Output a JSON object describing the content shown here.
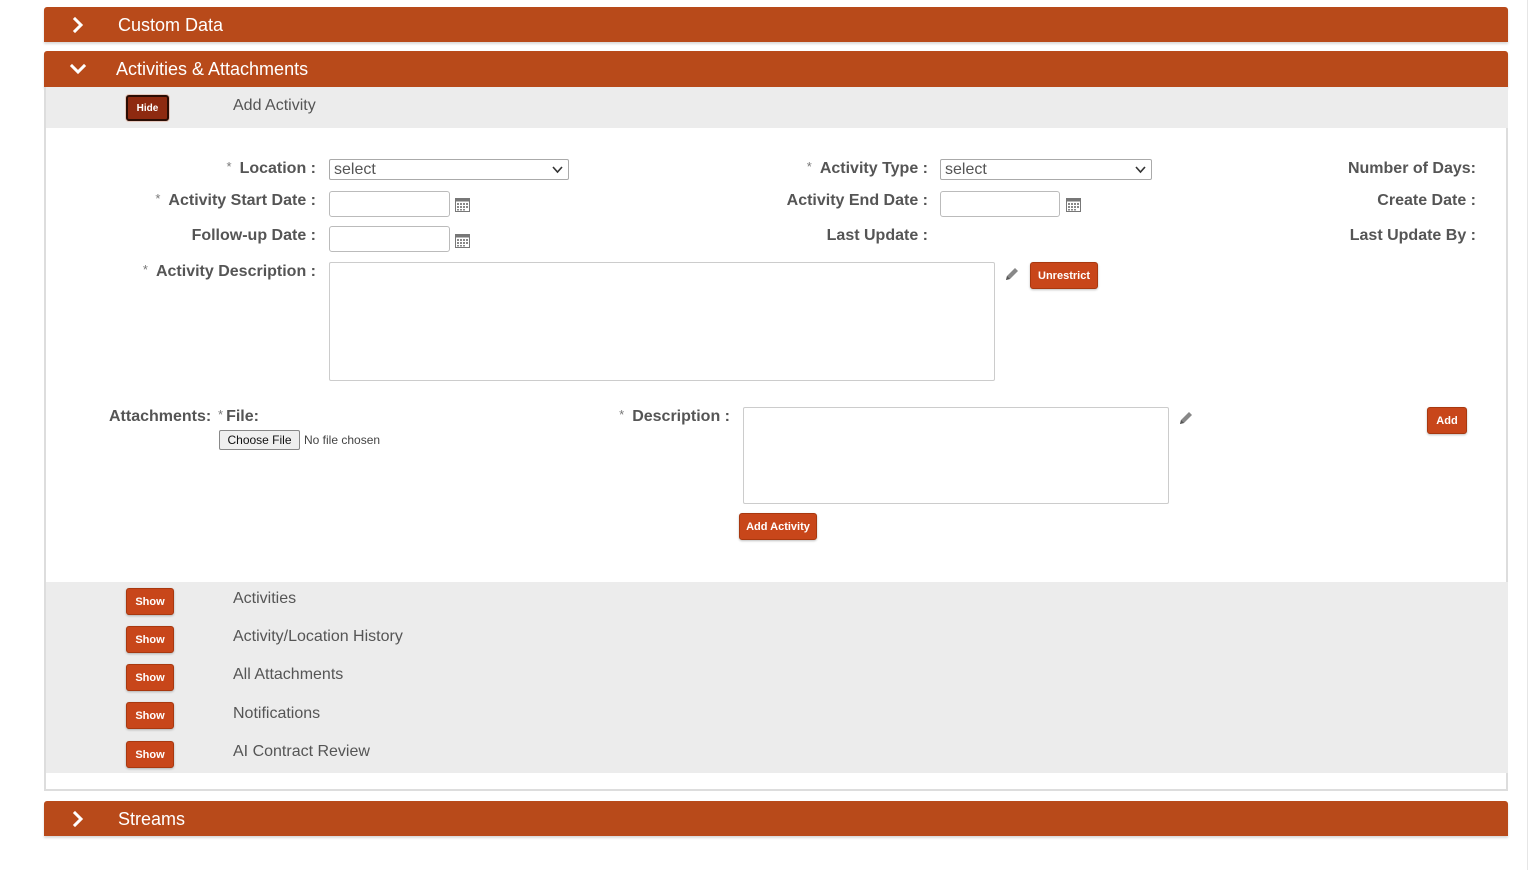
{
  "sections": {
    "custom_data": "Custom Data",
    "activities_attachments": "Activities & Attachments",
    "streams": "Streams"
  },
  "add_activity": {
    "toggle_label": "Hide",
    "title": "Add Activity"
  },
  "form": {
    "required_mark": "*",
    "location_label": "Location :",
    "location_value": "select",
    "activity_type_label": "Activity Type :",
    "activity_type_value": "select",
    "number_of_days_label": "Number of Days:",
    "start_date_label": "Activity Start Date :",
    "end_date_label": "Activity End Date :",
    "create_date_label": "Create Date :",
    "followup_date_label": "Follow-up Date :",
    "last_update_label": "Last Update :",
    "last_update_by_label": "Last Update By :",
    "description_label": "Activity Description :",
    "unrestrict_label": "Unrestrict"
  },
  "attachments": {
    "label": "Attachments:",
    "file_label": "File:",
    "choose_file": "Choose File",
    "no_file": "No file chosen",
    "description_label": "Description :",
    "add_label": "Add",
    "add_activity_label": "Add Activity"
  },
  "subsections": [
    {
      "button": "Show",
      "title": "Activities"
    },
    {
      "button": "Show",
      "title": "Activity/Location History"
    },
    {
      "button": "Show",
      "title": "All Attachments"
    },
    {
      "button": "Show",
      "title": "Notifications"
    },
    {
      "button": "Show",
      "title": "AI Contract Review"
    }
  ],
  "colors": {
    "header_bar": "#b84a1a",
    "button": "#c8461a",
    "grey_row": "#ececec"
  }
}
